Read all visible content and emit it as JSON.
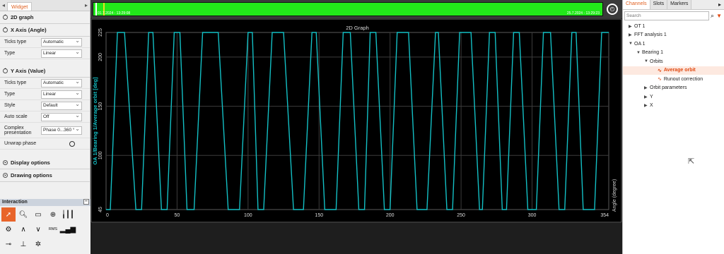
{
  "left": {
    "tab": "Widget",
    "sections": {
      "graph": "2D graph",
      "xaxis": "X Axis (Angle)",
      "yaxis": "Y Axis (Value)",
      "display": "Display options",
      "drawing": "Drawing options"
    },
    "x_rows": [
      {
        "label": "Ticks type",
        "value": "Automatic"
      },
      {
        "label": "Type",
        "value": "Linear"
      }
    ],
    "y_rows": [
      {
        "label": "Ticks type",
        "value": "Automatic"
      },
      {
        "label": "Type",
        "value": "Linear"
      },
      {
        "label": "Style",
        "value": "Default"
      },
      {
        "label": "Auto scale",
        "value": "Off"
      },
      {
        "label": "Complex presentation",
        "value": "Phase 0...360 °"
      }
    ],
    "unwrap": "Unwrap phase"
  },
  "interaction": {
    "title": "Interaction",
    "tools": [
      "pointer-icon",
      "zoom-icon",
      "rectangle-icon",
      "crosshair-icon",
      "bars-icon",
      "gear-icon",
      "peak-icon",
      "valley-icon",
      "rms-icon",
      "histogram-icon",
      "cursor-icon",
      "baseline-icon",
      "multi-cursor-icon"
    ],
    "rms_label": "RMS"
  },
  "timeline": {
    "start": "01.7.2024 - 13:29:08",
    "end": "25.7.2024 - 13:29:23",
    "bar_color": "#22e81a"
  },
  "chart_data": {
    "type": "line",
    "title": "2D Graph",
    "xlabel": "Angle (degree)",
    "ylabel": "OA 1/Bearing 1/Average orbit [deg]",
    "xlim": [
      0,
      354
    ],
    "ylim": [
      45,
      225
    ],
    "xticks": [
      "0",
      "50",
      "100",
      "150",
      "200",
      "250",
      "300",
      "354"
    ],
    "yticks": [
      "45",
      "100",
      "150",
      "200",
      "225"
    ],
    "line_color": "#13bfc4",
    "series": [
      {
        "values": [
          [
            0,
            45
          ],
          [
            3,
            45
          ],
          [
            8,
            225
          ],
          [
            13,
            225
          ],
          [
            21,
            45
          ],
          [
            25,
            45
          ],
          [
            30,
            225
          ],
          [
            33,
            225
          ],
          [
            39,
            45
          ],
          [
            43,
            45
          ],
          [
            48,
            225
          ],
          [
            52,
            225
          ],
          [
            57,
            45
          ],
          [
            62,
            45
          ],
          [
            68,
            225
          ],
          [
            79,
            225
          ],
          [
            86,
            45
          ],
          [
            94,
            45
          ],
          [
            100,
            225
          ],
          [
            103,
            225
          ],
          [
            107,
            45
          ],
          [
            111,
            45
          ],
          [
            117,
            225
          ],
          [
            125,
            225
          ],
          [
            132,
            45
          ],
          [
            139,
            45
          ],
          [
            145,
            225
          ],
          [
            148,
            225
          ],
          [
            154,
            45
          ],
          [
            162,
            45
          ],
          [
            167,
            225
          ],
          [
            172,
            225
          ],
          [
            178,
            45
          ],
          [
            182,
            45
          ],
          [
            186,
            225
          ],
          [
            190,
            225
          ],
          [
            196,
            45
          ],
          [
            200,
            45
          ],
          [
            205,
            225
          ],
          [
            213,
            225
          ],
          [
            219,
            45
          ],
          [
            226,
            45
          ],
          [
            232,
            225
          ],
          [
            234,
            225
          ],
          [
            240,
            45
          ],
          [
            244,
            45
          ],
          [
            249,
            225
          ],
          [
            257,
            225
          ],
          [
            263,
            45
          ],
          [
            265,
            45
          ],
          [
            270,
            225
          ],
          [
            274,
            225
          ],
          [
            279,
            45
          ],
          [
            282,
            45
          ],
          [
            287,
            225
          ],
          [
            291,
            225
          ],
          [
            297,
            45
          ],
          [
            303,
            45
          ],
          [
            308,
            225
          ],
          [
            313,
            225
          ],
          [
            319,
            45
          ],
          [
            323,
            45
          ],
          [
            328,
            225
          ],
          [
            331,
            225
          ],
          [
            336,
            45
          ],
          [
            344,
            45
          ],
          [
            349,
            225
          ],
          [
            354,
            225
          ]
        ]
      }
    ]
  },
  "right": {
    "tabs": [
      "Channels",
      "Slots",
      "Markers"
    ],
    "search": "Search",
    "tree": [
      {
        "label": "OT 1",
        "level": 0,
        "arrow": "▶"
      },
      {
        "label": "FFT analysis 1",
        "level": 0,
        "arrow": "▶"
      },
      {
        "label": "OA 1",
        "level": 0,
        "arrow": "▼"
      },
      {
        "label": "Bearing 1",
        "level": 1,
        "arrow": "▼"
      },
      {
        "label": "Orbits",
        "level": 2,
        "arrow": "▼"
      },
      {
        "label": "Average orbit",
        "level": 3,
        "arrow": "",
        "selected": true
      },
      {
        "label": "Runout correction",
        "level": 3,
        "arrow": ""
      },
      {
        "label": "Orbit parameters",
        "level": 2,
        "arrow": "▶"
      },
      {
        "label": "Y",
        "level": 2,
        "arrow": "▶"
      },
      {
        "label": "X",
        "level": 2,
        "arrow": "▶"
      }
    ]
  }
}
